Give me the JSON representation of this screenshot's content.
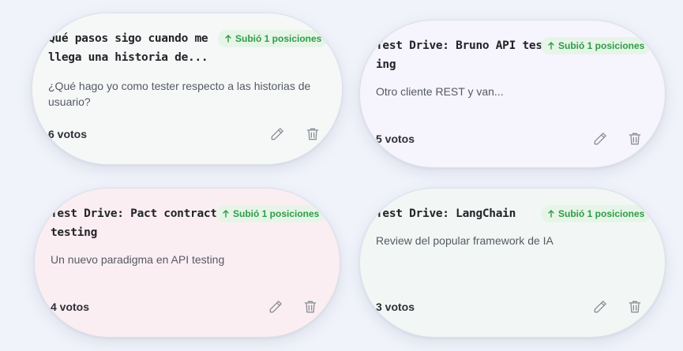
{
  "cards": [
    {
      "title_line1": "Qué pasos sigo cuando me",
      "title_line2": "llega una historia de...",
      "badge": "Subió 1 posiciones",
      "desc_line1": "¿Qué hago yo como tester respecto a las historias de",
      "desc_line2": "usuario?",
      "votes": "6 votos",
      "edit_icon": "pencil-icon",
      "delete_icon": "trash-icon"
    },
    {
      "title_line1": "Test Drive: Bruno API test-",
      "title_line2": "ing",
      "badge": "Subió 1 posiciones",
      "desc_line1": "Otro cliente REST y van...",
      "votes": "5 votos",
      "edit_icon": "pencil-icon",
      "delete_icon": "trash-icon"
    },
    {
      "title_line1": "Test Drive: Pact contract",
      "title_line2": "testing",
      "badge": "Subió 1 posiciones",
      "desc_line1": "Un nuevo paradigma en API testing",
      "votes": "4 votos",
      "edit_icon": "pencil-icon",
      "delete_icon": "trash-icon"
    },
    {
      "title_line1": "Test Drive: LangChain",
      "badge": "Subió 1 posiciones",
      "desc_line1": "Review del popular framework de IA",
      "votes": "3 votos",
      "edit_icon": "pencil-icon",
      "delete_icon": "trash-icon"
    }
  ],
  "colors": {
    "badge_bg": "#e6f5e8",
    "badge_text": "#2e9c47",
    "card_1_bg": "#f6f8f8",
    "card_2_bg": "#f6f4fc",
    "card_3_bg": "#fbeef2",
    "card_4_bg": "#f2f7f5",
    "icon": "#8b8f96"
  }
}
